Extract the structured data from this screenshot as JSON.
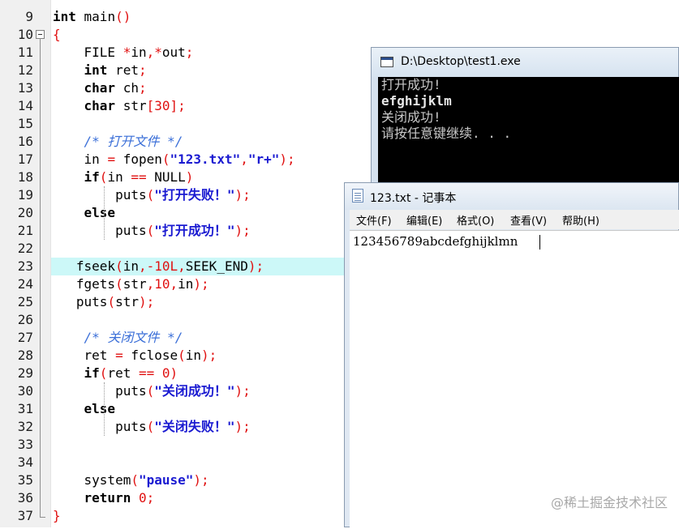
{
  "editor": {
    "lines": [
      {
        "n": "9",
        "segs": [
          {
            "t": "int",
            "c": "kw"
          },
          {
            "t": " main",
            "c": "plain"
          },
          {
            "t": "()",
            "c": "op"
          }
        ]
      },
      {
        "n": "10",
        "segs": [
          {
            "t": "{",
            "c": "op"
          }
        ]
      },
      {
        "n": "11",
        "segs": [
          {
            "t": "    FILE ",
            "c": "plain"
          },
          {
            "t": "*",
            "c": "op"
          },
          {
            "t": "in",
            "c": "plain"
          },
          {
            "t": ",*",
            "c": "op"
          },
          {
            "t": "out",
            "c": "plain"
          },
          {
            "t": ";",
            "c": "op"
          }
        ]
      },
      {
        "n": "12",
        "segs": [
          {
            "t": "    ",
            "c": "plain"
          },
          {
            "t": "int",
            "c": "kw"
          },
          {
            "t": " ret",
            "c": "plain"
          },
          {
            "t": ";",
            "c": "op"
          }
        ]
      },
      {
        "n": "13",
        "segs": [
          {
            "t": "    ",
            "c": "plain"
          },
          {
            "t": "char",
            "c": "kw"
          },
          {
            "t": " ch",
            "c": "plain"
          },
          {
            "t": ";",
            "c": "op"
          }
        ]
      },
      {
        "n": "14",
        "segs": [
          {
            "t": "    ",
            "c": "plain"
          },
          {
            "t": "char",
            "c": "kw"
          },
          {
            "t": " str",
            "c": "plain"
          },
          {
            "t": "[",
            "c": "op"
          },
          {
            "t": "30",
            "c": "num"
          },
          {
            "t": "];",
            "c": "op"
          }
        ]
      },
      {
        "n": "15",
        "segs": []
      },
      {
        "n": "16",
        "segs": [
          {
            "t": "    ",
            "c": "plain"
          },
          {
            "t": "/* 打开文件 */",
            "c": "cm"
          }
        ]
      },
      {
        "n": "17",
        "segs": [
          {
            "t": "    in ",
            "c": "plain"
          },
          {
            "t": "=",
            "c": "op"
          },
          {
            "t": " fopen",
            "c": "plain"
          },
          {
            "t": "(",
            "c": "op"
          },
          {
            "t": "\"123.txt\"",
            "c": "str"
          },
          {
            "t": ",",
            "c": "op"
          },
          {
            "t": "\"r+\"",
            "c": "str"
          },
          {
            "t": ");",
            "c": "op"
          }
        ]
      },
      {
        "n": "18",
        "segs": [
          {
            "t": "    ",
            "c": "plain"
          },
          {
            "t": "if",
            "c": "kw"
          },
          {
            "t": "(",
            "c": "op"
          },
          {
            "t": "in ",
            "c": "plain"
          },
          {
            "t": "==",
            "c": "op"
          },
          {
            "t": " NULL",
            "c": "plain"
          },
          {
            "t": ")",
            "c": "op"
          }
        ]
      },
      {
        "n": "19",
        "segs": [
          {
            "t": "        puts",
            "c": "plain"
          },
          {
            "t": "(",
            "c": "op"
          },
          {
            "t": "\"打开失败！\"",
            "c": "str"
          },
          {
            "t": ");",
            "c": "op"
          }
        ]
      },
      {
        "n": "20",
        "segs": [
          {
            "t": "    ",
            "c": "plain"
          },
          {
            "t": "else",
            "c": "kw"
          }
        ]
      },
      {
        "n": "21",
        "segs": [
          {
            "t": "        puts",
            "c": "plain"
          },
          {
            "t": "(",
            "c": "op"
          },
          {
            "t": "\"打开成功！\"",
            "c": "str"
          },
          {
            "t": ");",
            "c": "op"
          }
        ]
      },
      {
        "n": "22",
        "segs": []
      },
      {
        "n": "23",
        "segs": [
          {
            "t": "   fseek",
            "c": "plain"
          },
          {
            "t": "(",
            "c": "op"
          },
          {
            "t": "in",
            "c": "plain"
          },
          {
            "t": ",-",
            "c": "op"
          },
          {
            "t": "10L",
            "c": "num"
          },
          {
            "t": ",",
            "c": "op"
          },
          {
            "t": "SEEK_END",
            "c": "plain"
          },
          {
            "t": ");",
            "c": "op"
          }
        ],
        "highlight": true
      },
      {
        "n": "24",
        "segs": [
          {
            "t": "   fgets",
            "c": "plain"
          },
          {
            "t": "(",
            "c": "op"
          },
          {
            "t": "str",
            "c": "plain"
          },
          {
            "t": ",",
            "c": "op"
          },
          {
            "t": "10",
            "c": "num"
          },
          {
            "t": ",",
            "c": "op"
          },
          {
            "t": "in",
            "c": "plain"
          },
          {
            "t": ");",
            "c": "op"
          }
        ]
      },
      {
        "n": "25",
        "segs": [
          {
            "t": "   puts",
            "c": "plain"
          },
          {
            "t": "(",
            "c": "op"
          },
          {
            "t": "str",
            "c": "plain"
          },
          {
            "t": ");",
            "c": "op"
          }
        ]
      },
      {
        "n": "26",
        "segs": []
      },
      {
        "n": "27",
        "segs": [
          {
            "t": "    ",
            "c": "plain"
          },
          {
            "t": "/* 关闭文件 */",
            "c": "cm"
          }
        ]
      },
      {
        "n": "28",
        "segs": [
          {
            "t": "    ret ",
            "c": "plain"
          },
          {
            "t": "=",
            "c": "op"
          },
          {
            "t": " fclose",
            "c": "plain"
          },
          {
            "t": "(",
            "c": "op"
          },
          {
            "t": "in",
            "c": "plain"
          },
          {
            "t": ");",
            "c": "op"
          }
        ]
      },
      {
        "n": "29",
        "segs": [
          {
            "t": "    ",
            "c": "plain"
          },
          {
            "t": "if",
            "c": "kw"
          },
          {
            "t": "(",
            "c": "op"
          },
          {
            "t": "ret ",
            "c": "plain"
          },
          {
            "t": "==",
            "c": "op"
          },
          {
            "t": " ",
            "c": "plain"
          },
          {
            "t": "0",
            "c": "num"
          },
          {
            "t": ")",
            "c": "op"
          }
        ]
      },
      {
        "n": "30",
        "segs": [
          {
            "t": "        puts",
            "c": "plain"
          },
          {
            "t": "(",
            "c": "op"
          },
          {
            "t": "\"关闭成功！\"",
            "c": "str"
          },
          {
            "t": ");",
            "c": "op"
          }
        ]
      },
      {
        "n": "31",
        "segs": [
          {
            "t": "    ",
            "c": "plain"
          },
          {
            "t": "else",
            "c": "kw"
          }
        ]
      },
      {
        "n": "32",
        "segs": [
          {
            "t": "        puts",
            "c": "plain"
          },
          {
            "t": "(",
            "c": "op"
          },
          {
            "t": "\"关闭失败！\"",
            "c": "str"
          },
          {
            "t": ");",
            "c": "op"
          }
        ]
      },
      {
        "n": "33",
        "segs": []
      },
      {
        "n": "34",
        "segs": []
      },
      {
        "n": "35",
        "segs": [
          {
            "t": "    system",
            "c": "plain"
          },
          {
            "t": "(",
            "c": "op"
          },
          {
            "t": "\"pause\"",
            "c": "str"
          },
          {
            "t": ");",
            "c": "op"
          }
        ]
      },
      {
        "n": "36",
        "segs": [
          {
            "t": "    ",
            "c": "plain"
          },
          {
            "t": "return",
            "c": "kw"
          },
          {
            "t": " ",
            "c": "plain"
          },
          {
            "t": "0",
            "c": "num"
          },
          {
            "t": ";",
            "c": "op"
          }
        ]
      },
      {
        "n": "37",
        "segs": [
          {
            "t": "}",
            "c": "op"
          }
        ]
      }
    ]
  },
  "console": {
    "title": "D:\\Desktop\\test1.exe",
    "lines": [
      "打开成功!",
      "efghijklm",
      "关闭成功!",
      "请按任意键继续. . ."
    ]
  },
  "notepad": {
    "title": "123.txt - 记事本",
    "menu": [
      "文件(F)",
      "编辑(E)",
      "格式(O)",
      "查看(V)",
      "帮助(H)"
    ],
    "content": "123456789abcdefghijklmn"
  },
  "watermark": "@稀土掘金技术社区",
  "colors": {
    "keyword": "#000000",
    "string": "#1a1ad1",
    "number": "#e01010",
    "comment": "#3b6fd8",
    "highlight": "#ccf8f8"
  }
}
